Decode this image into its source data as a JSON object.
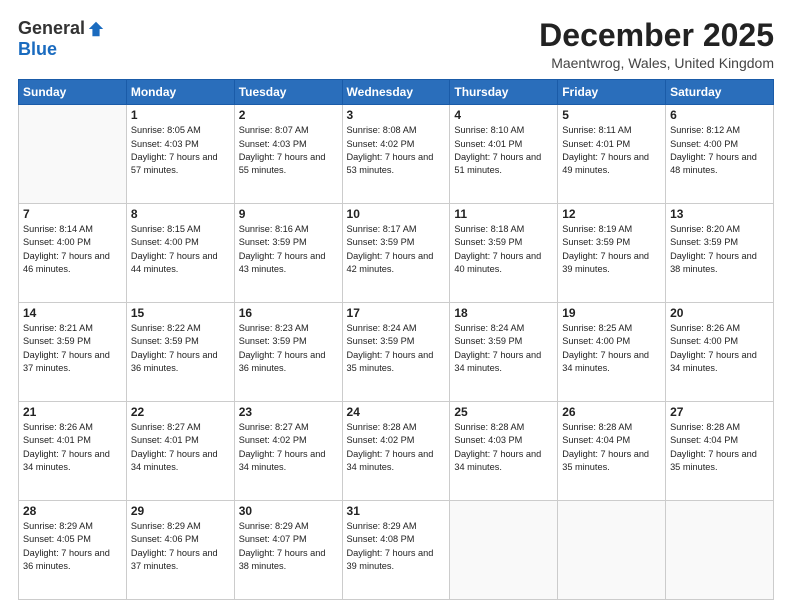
{
  "header": {
    "logo_general": "General",
    "logo_blue": "Blue",
    "title": "December 2025",
    "location": "Maentwrog, Wales, United Kingdom"
  },
  "days_of_week": [
    "Sunday",
    "Monday",
    "Tuesday",
    "Wednesday",
    "Thursday",
    "Friday",
    "Saturday"
  ],
  "weeks": [
    [
      {
        "day": "",
        "sunrise": "",
        "sunset": "",
        "daylight": ""
      },
      {
        "day": "1",
        "sunrise": "Sunrise: 8:05 AM",
        "sunset": "Sunset: 4:03 PM",
        "daylight": "Daylight: 7 hours and 57 minutes."
      },
      {
        "day": "2",
        "sunrise": "Sunrise: 8:07 AM",
        "sunset": "Sunset: 4:03 PM",
        "daylight": "Daylight: 7 hours and 55 minutes."
      },
      {
        "day": "3",
        "sunrise": "Sunrise: 8:08 AM",
        "sunset": "Sunset: 4:02 PM",
        "daylight": "Daylight: 7 hours and 53 minutes."
      },
      {
        "day": "4",
        "sunrise": "Sunrise: 8:10 AM",
        "sunset": "Sunset: 4:01 PM",
        "daylight": "Daylight: 7 hours and 51 minutes."
      },
      {
        "day": "5",
        "sunrise": "Sunrise: 8:11 AM",
        "sunset": "Sunset: 4:01 PM",
        "daylight": "Daylight: 7 hours and 49 minutes."
      },
      {
        "day": "6",
        "sunrise": "Sunrise: 8:12 AM",
        "sunset": "Sunset: 4:00 PM",
        "daylight": "Daylight: 7 hours and 48 minutes."
      }
    ],
    [
      {
        "day": "7",
        "sunrise": "Sunrise: 8:14 AM",
        "sunset": "Sunset: 4:00 PM",
        "daylight": "Daylight: 7 hours and 46 minutes."
      },
      {
        "day": "8",
        "sunrise": "Sunrise: 8:15 AM",
        "sunset": "Sunset: 4:00 PM",
        "daylight": "Daylight: 7 hours and 44 minutes."
      },
      {
        "day": "9",
        "sunrise": "Sunrise: 8:16 AM",
        "sunset": "Sunset: 3:59 PM",
        "daylight": "Daylight: 7 hours and 43 minutes."
      },
      {
        "day": "10",
        "sunrise": "Sunrise: 8:17 AM",
        "sunset": "Sunset: 3:59 PM",
        "daylight": "Daylight: 7 hours and 42 minutes."
      },
      {
        "day": "11",
        "sunrise": "Sunrise: 8:18 AM",
        "sunset": "Sunset: 3:59 PM",
        "daylight": "Daylight: 7 hours and 40 minutes."
      },
      {
        "day": "12",
        "sunrise": "Sunrise: 8:19 AM",
        "sunset": "Sunset: 3:59 PM",
        "daylight": "Daylight: 7 hours and 39 minutes."
      },
      {
        "day": "13",
        "sunrise": "Sunrise: 8:20 AM",
        "sunset": "Sunset: 3:59 PM",
        "daylight": "Daylight: 7 hours and 38 minutes."
      }
    ],
    [
      {
        "day": "14",
        "sunrise": "Sunrise: 8:21 AM",
        "sunset": "Sunset: 3:59 PM",
        "daylight": "Daylight: 7 hours and 37 minutes."
      },
      {
        "day": "15",
        "sunrise": "Sunrise: 8:22 AM",
        "sunset": "Sunset: 3:59 PM",
        "daylight": "Daylight: 7 hours and 36 minutes."
      },
      {
        "day": "16",
        "sunrise": "Sunrise: 8:23 AM",
        "sunset": "Sunset: 3:59 PM",
        "daylight": "Daylight: 7 hours and 36 minutes."
      },
      {
        "day": "17",
        "sunrise": "Sunrise: 8:24 AM",
        "sunset": "Sunset: 3:59 PM",
        "daylight": "Daylight: 7 hours and 35 minutes."
      },
      {
        "day": "18",
        "sunrise": "Sunrise: 8:24 AM",
        "sunset": "Sunset: 3:59 PM",
        "daylight": "Daylight: 7 hours and 34 minutes."
      },
      {
        "day": "19",
        "sunrise": "Sunrise: 8:25 AM",
        "sunset": "Sunset: 4:00 PM",
        "daylight": "Daylight: 7 hours and 34 minutes."
      },
      {
        "day": "20",
        "sunrise": "Sunrise: 8:26 AM",
        "sunset": "Sunset: 4:00 PM",
        "daylight": "Daylight: 7 hours and 34 minutes."
      }
    ],
    [
      {
        "day": "21",
        "sunrise": "Sunrise: 8:26 AM",
        "sunset": "Sunset: 4:01 PM",
        "daylight": "Daylight: 7 hours and 34 minutes."
      },
      {
        "day": "22",
        "sunrise": "Sunrise: 8:27 AM",
        "sunset": "Sunset: 4:01 PM",
        "daylight": "Daylight: 7 hours and 34 minutes."
      },
      {
        "day": "23",
        "sunrise": "Sunrise: 8:27 AM",
        "sunset": "Sunset: 4:02 PM",
        "daylight": "Daylight: 7 hours and 34 minutes."
      },
      {
        "day": "24",
        "sunrise": "Sunrise: 8:28 AM",
        "sunset": "Sunset: 4:02 PM",
        "daylight": "Daylight: 7 hours and 34 minutes."
      },
      {
        "day": "25",
        "sunrise": "Sunrise: 8:28 AM",
        "sunset": "Sunset: 4:03 PM",
        "daylight": "Daylight: 7 hours and 34 minutes."
      },
      {
        "day": "26",
        "sunrise": "Sunrise: 8:28 AM",
        "sunset": "Sunset: 4:04 PM",
        "daylight": "Daylight: 7 hours and 35 minutes."
      },
      {
        "day": "27",
        "sunrise": "Sunrise: 8:28 AM",
        "sunset": "Sunset: 4:04 PM",
        "daylight": "Daylight: 7 hours and 35 minutes."
      }
    ],
    [
      {
        "day": "28",
        "sunrise": "Sunrise: 8:29 AM",
        "sunset": "Sunset: 4:05 PM",
        "daylight": "Daylight: 7 hours and 36 minutes."
      },
      {
        "day": "29",
        "sunrise": "Sunrise: 8:29 AM",
        "sunset": "Sunset: 4:06 PM",
        "daylight": "Daylight: 7 hours and 37 minutes."
      },
      {
        "day": "30",
        "sunrise": "Sunrise: 8:29 AM",
        "sunset": "Sunset: 4:07 PM",
        "daylight": "Daylight: 7 hours and 38 minutes."
      },
      {
        "day": "31",
        "sunrise": "Sunrise: 8:29 AM",
        "sunset": "Sunset: 4:08 PM",
        "daylight": "Daylight: 7 hours and 39 minutes."
      },
      {
        "day": "",
        "sunrise": "",
        "sunset": "",
        "daylight": ""
      },
      {
        "day": "",
        "sunrise": "",
        "sunset": "",
        "daylight": ""
      },
      {
        "day": "",
        "sunrise": "",
        "sunset": "",
        "daylight": ""
      }
    ]
  ]
}
